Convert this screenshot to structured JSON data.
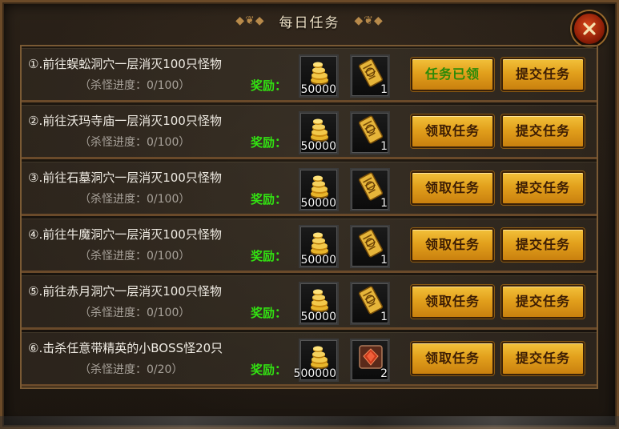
{
  "window": {
    "title": "每日任务",
    "left_ornament": "◆❦◆",
    "right_ornament": "◆❦◆",
    "close_icon": "close-x-icon"
  },
  "reward_label": "奖励：",
  "tasks": [
    {
      "name": "①.前往蜈蚣洞穴一层消灭100只怪物",
      "progress": "（杀怪进度：0/100）",
      "gold": "50000",
      "item_count": "1",
      "item_icon": "scroll-icon",
      "claim_label": "任务已领",
      "claimed": true,
      "submit_label": "提交任务"
    },
    {
      "name": "②.前往沃玛寺庙一层消灭100只怪物",
      "progress": "（杀怪进度：0/100）",
      "gold": "50000",
      "item_count": "1",
      "item_icon": "scroll-icon",
      "claim_label": "领取任务",
      "claimed": false,
      "submit_label": "提交任务"
    },
    {
      "name": "③.前往石墓洞穴一层消灭100只怪物",
      "progress": "（杀怪进度：0/100）",
      "gold": "50000",
      "item_count": "1",
      "item_icon": "scroll-icon",
      "claim_label": "领取任务",
      "claimed": false,
      "submit_label": "提交任务"
    },
    {
      "name": "④.前往牛魔洞穴一层消灭100只怪物",
      "progress": "（杀怪进度：0/100）",
      "gold": "50000",
      "item_count": "1",
      "item_icon": "scroll-icon",
      "claim_label": "领取任务",
      "claimed": false,
      "submit_label": "提交任务"
    },
    {
      "name": "⑤.前往赤月洞穴一层消灭100只怪物",
      "progress": "（杀怪进度：0/100）",
      "gold": "50000",
      "item_count": "1",
      "item_icon": "scroll-icon",
      "claim_label": "领取任务",
      "claimed": false,
      "submit_label": "提交任务"
    },
    {
      "name": "⑥.击杀任意带精英的小BOSS怪20只",
      "progress": "（杀怪进度：0/20）",
      "gold": "500000",
      "item_count": "2",
      "item_icon": "red-gem-icon",
      "claim_label": "领取任务",
      "claimed": false,
      "submit_label": "提交任务"
    }
  ],
  "colors": {
    "reward_green": "#32e012",
    "claimed_text": "#2b8a08",
    "button_gold": "#e2a01c"
  }
}
